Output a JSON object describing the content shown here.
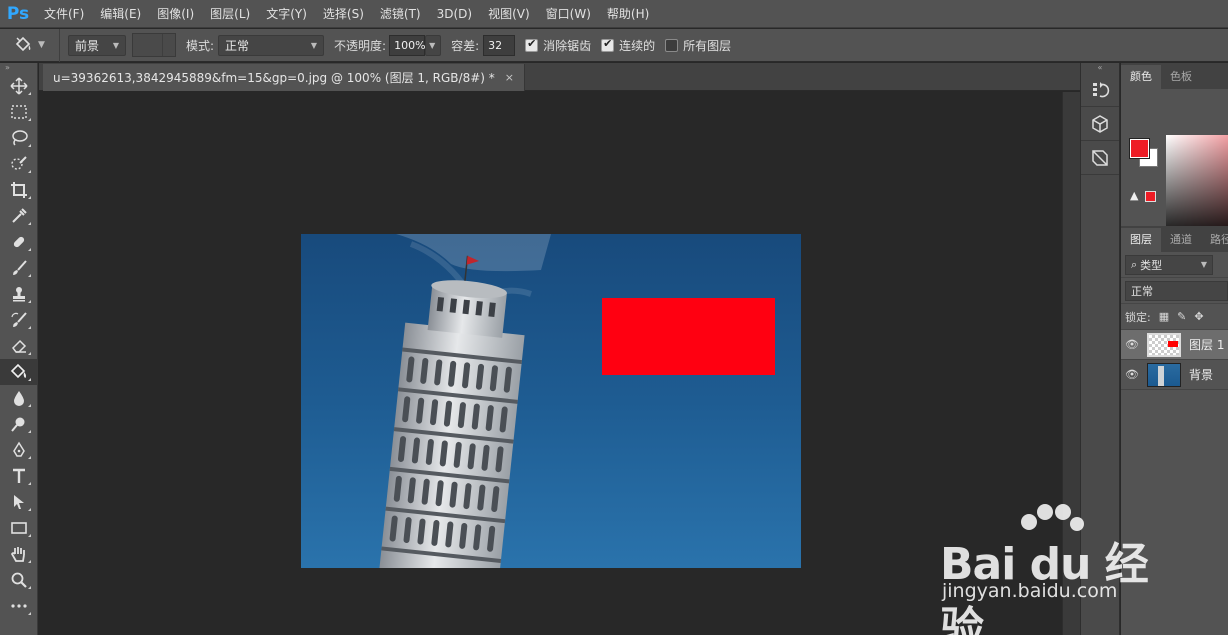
{
  "app": {
    "logo": "Ps"
  },
  "menu": [
    "文件(F)",
    "编辑(E)",
    "图像(I)",
    "图层(L)",
    "文字(Y)",
    "选择(S)",
    "滤镜(T)",
    "3D(D)",
    "视图(V)",
    "窗口(W)",
    "帮助(H)"
  ],
  "options": {
    "tool_icon": "paint-bucket-icon",
    "fill_source": "前景",
    "mode_label": "模式:",
    "mode_value": "正常",
    "opacity_label": "不透明度:",
    "opacity_value": "100%",
    "tolerance_label": "容差:",
    "tolerance_value": "32",
    "antialias_label": "消除锯齿",
    "antialias_checked": true,
    "contiguous_label": "连续的",
    "contiguous_checked": true,
    "all_layers_label": "所有图层",
    "all_layers_checked": false
  },
  "document": {
    "tab_title": "u=39362613,3842945889&fm=15&gp=0.jpg @ 100% (图层 1, RGB/8#) *",
    "close_glyph": "×",
    "red_rect_color": "#ff0011",
    "sky_color": "#1f5f96"
  },
  "tools": [
    "move-icon",
    "marquee-icon",
    "lasso-icon",
    "quick-select-icon",
    "crop-icon",
    "eyedropper-icon",
    "healing-icon",
    "brush-icon",
    "stamp-icon",
    "history-brush-icon",
    "eraser-icon",
    "paint-bucket-icon",
    "blur-icon",
    "dodge-icon",
    "pen-icon",
    "type-icon",
    "path-select-icon",
    "rectangle-icon",
    "hand-icon",
    "zoom-icon",
    "more-icon"
  ],
  "panels": {
    "color_tabs": [
      "颜色",
      "色板"
    ],
    "foreground_color": "#ee1c25",
    "background_color": "#ffffff",
    "layers_tabs": [
      "图层",
      "通道",
      "路径"
    ],
    "kind_filter": "类型",
    "blend_mode": "正常",
    "lock_label": "锁定:",
    "layers": [
      {
        "name": "图层 1",
        "selected": true
      },
      {
        "name": "背景",
        "selected": false
      }
    ]
  },
  "watermark": {
    "text": "Bai du 经验",
    "url": "jingyan.baidu.com"
  }
}
